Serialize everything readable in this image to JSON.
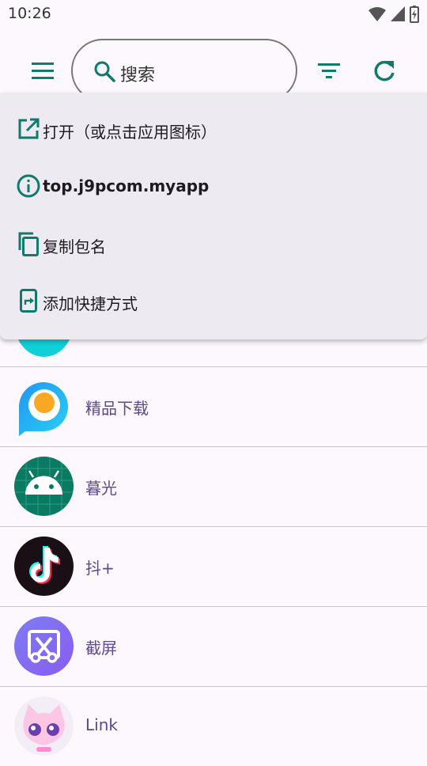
{
  "status_bar": {
    "time": "10:26"
  },
  "search": {
    "placeholder": "搜索"
  },
  "context_menu": {
    "items": [
      {
        "label": "打开（或点击应用图标）",
        "icon": "open-in-new-icon"
      },
      {
        "label": "top.j9pcom.myapp",
        "icon": "info-icon"
      },
      {
        "label": "复制包名",
        "icon": "copy-icon"
      },
      {
        "label": "添加快捷方式",
        "icon": "add-shortcut-icon"
      }
    ]
  },
  "app_list": [
    {
      "name": "精品下载",
      "icon": "app-icon-jingpin"
    },
    {
      "name": "暮光",
      "icon": "android-icon"
    },
    {
      "name": "抖+",
      "icon": "tiktok-icon"
    },
    {
      "name": "截屏",
      "icon": "screenshot-icon"
    },
    {
      "name": "Link",
      "icon": "cat-avatar-icon"
    }
  ],
  "colors": {
    "accent": "#0f7b6c",
    "name_text": "#5b4a8c",
    "menu_bg": "#eeeaf2",
    "background": "#fcf8fd"
  }
}
